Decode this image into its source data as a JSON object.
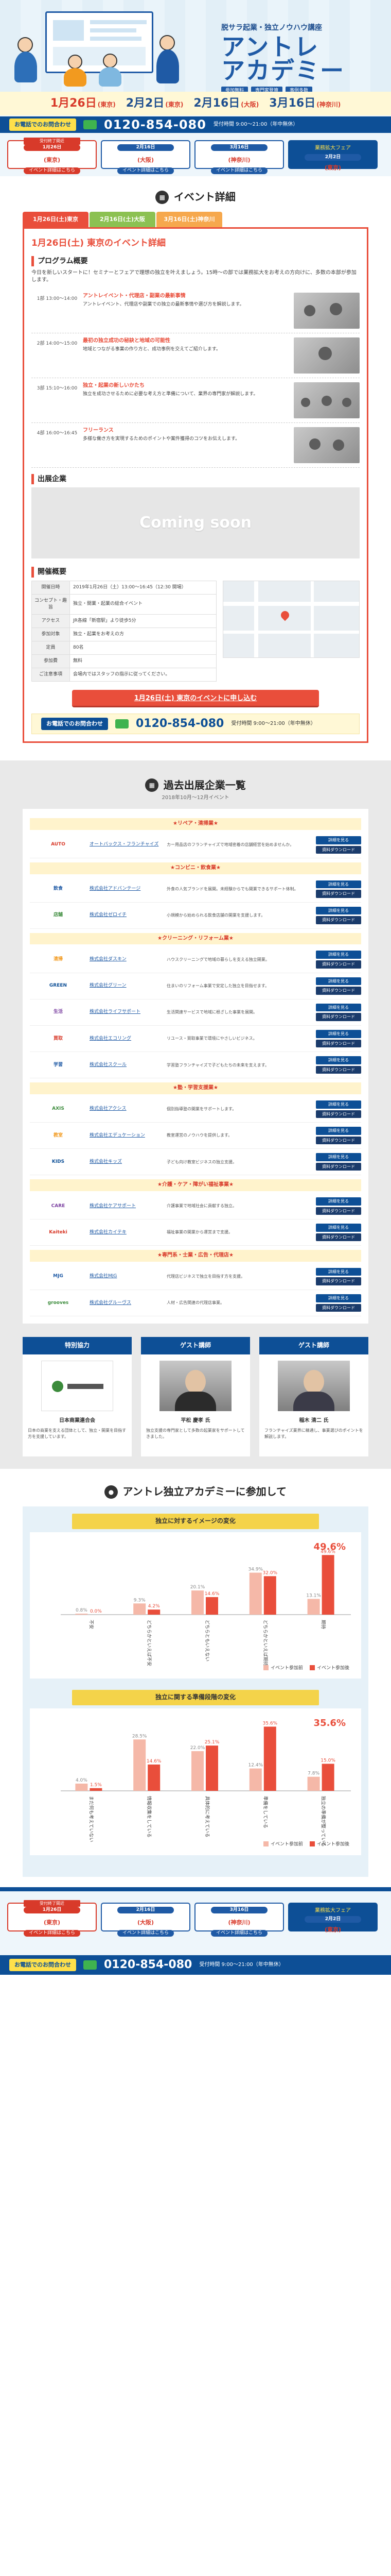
{
  "hero": {
    "subtitle": "脱サラ起業・独立ノウハウ講座",
    "title1": "アントレ",
    "title2": "アカデミー",
    "tags": [
      "参加無料",
      "専門家登壇",
      "事例多数"
    ]
  },
  "dates": [
    {
      "date": "1月26日",
      "day": "(東京)"
    },
    {
      "date": "2月2日",
      "day": "(東京)"
    },
    {
      "date": "2月16日",
      "day": "(大阪)"
    },
    {
      "date": "3月16日",
      "day": "(神奈川)"
    }
  ],
  "tel": {
    "label": "お電話でのお問合わせ",
    "number": "0120-854-080",
    "hours": "受付時間 9:00〜21:00（年中無休）"
  },
  "date_buttons": [
    {
      "date": "1月26日",
      "day": "(東京)",
      "sub": "イベント詳細はこちら",
      "ribbon": "受付終了間近"
    },
    {
      "date": "2月16日",
      "day": "(大阪)",
      "sub": "イベント詳細はこちら"
    },
    {
      "date": "3月16日",
      "day": "(神奈川)",
      "sub": "イベント詳細はこちら"
    },
    {
      "top": "業務拡大フェア",
      "date": "2月2日",
      "day": "(東京)",
      "sub": "イベント詳細はこちら"
    }
  ],
  "event_section": {
    "icon": "▦",
    "title": "イベント詳細"
  },
  "tabs": [
    "1月26日(土)東京",
    "2月16日(土)大阪",
    "3月16日(土)神奈川"
  ],
  "event": {
    "title": "1月26日(土) 東京のイベント詳細",
    "program_heading": "プログラム概要",
    "intro": "今日を新しいスタートに！セミナーとフェアで理想の独立を叶えましょう。15時〜の部では業務拡大をお考えの方向けに、多数の本部が参加します。",
    "program": [
      {
        "time": "1部\n13:00〜14:00",
        "head": "アントレイベント・代理店・副業の最新事情",
        "body": "アントレイベント、代理店や副業での独立の最新事情や選び方を解説します。"
      },
      {
        "time": "2部\n14:00〜15:00",
        "head": "最初の独立成功の秘訣と地域の可能性",
        "body": "地域とつながる事業の作り方と、成功事例を交えてご紹介します。"
      },
      {
        "time": "3部\n15:10〜16:00",
        "head": "独立・起業の新しいかたち",
        "body": "独立を成功させるために必要な考え方と準備について、業界の専門家が解説します。"
      },
      {
        "time": "4部\n16:00〜16:45",
        "head": "フリーランス",
        "body": "多様な働き方を実現するためのポイントや案件獲得のコツをお伝えします。"
      }
    ],
    "exhibitors_heading": "出展企業",
    "coming_soon": "Coming soon",
    "detail_heading": "開催概要",
    "detail_rows": [
      {
        "k": "開催日時",
        "v": "2019年1月26日（土）13:00〜16:45（12:30 開場）"
      },
      {
        "k": "コンセプト・趣旨",
        "v": "独立・開業・起業の総合イベント"
      },
      {
        "k": "アクセス",
        "v": "JR各線「新宿駅」より徒歩5分"
      },
      {
        "k": "参加対象",
        "v": "独立・起業をお考えの方"
      },
      {
        "k": "定員",
        "v": "80名"
      },
      {
        "k": "参加費",
        "v": "無料"
      },
      {
        "k": "ご注意事項",
        "v": "会場内ではスタッフの指示に従ってください。"
      }
    ],
    "cta": "1月26日(土) 東京のイベントに申し込む"
  },
  "past": {
    "icon": "▦",
    "title": "過去出展企業一覧",
    "sub": "2018年10月〜12月イベント",
    "buttons": [
      "詳細を見る",
      "資料ダウンロード"
    ],
    "categories": [
      {
        "name": "★リペア・清掃業★",
        "items": [
          {
            "logo": "AUTO",
            "name": "オートバックス・フランチャイズ",
            "desc": "カー用品店のフランチャイズで地域密着の店舗経営を始めませんか。"
          }
        ]
      },
      {
        "name": "★コンビニ・飲食業★",
        "items": [
          {
            "logo": "飲食",
            "name": "株式会社アドバンテージ",
            "desc": "外食の人気ブランドを展開。未経験からでも開業できるサポート体制。"
          },
          {
            "logo": "店舗",
            "name": "株式会社ゼロイチ",
            "desc": "小規模から始められる飲食店舗の開業を支援します。"
          }
        ]
      },
      {
        "name": "★クリーニング・リフォーム業★",
        "items": [
          {
            "logo": "清掃",
            "name": "株式会社ダスキン",
            "desc": "ハウスクリーニングで地域の暮らしを支える独立開業。"
          },
          {
            "logo": "GREEN",
            "name": "株式会社グリーン",
            "desc": "住まいのリフォーム事業で安定した独立を目指せます。"
          },
          {
            "logo": "生活",
            "name": "株式会社ライフサポート",
            "desc": "生活関連サービスで地域に根ざした事業を展開。"
          },
          {
            "logo": "買取",
            "name": "株式会社エコリング",
            "desc": "リユース・買取事業で環境にやさしいビジネス。"
          },
          {
            "logo": "学習",
            "name": "株式会社スクール",
            "desc": "学習塾フランチャイズで子どもたちの未来を支えます。"
          }
        ]
      },
      {
        "name": "★塾・学習支援業★",
        "items": [
          {
            "logo": "AXIS",
            "name": "株式会社アクシス",
            "desc": "個別指導塾の開業をサポートします。"
          },
          {
            "logo": "教室",
            "name": "株式会社エデュケーション",
            "desc": "教室運営のノウハウを提供します。"
          },
          {
            "logo": "KIDS",
            "name": "株式会社キッズ",
            "desc": "子ども向け教室ビジネスの独立支援。"
          }
        ]
      },
      {
        "name": "★介護・ケア・障がい福祉事業★",
        "items": [
          {
            "logo": "CARE",
            "name": "株式会社ケアサポート",
            "desc": "介護事業で地域社会に貢献する独立。"
          },
          {
            "logo": "Kaiteki",
            "name": "株式会社カイテキ",
            "desc": "福祉事業の開業から運営まで支援。"
          }
        ]
      },
      {
        "name": "★専門系・士業・広告・代理店★",
        "items": [
          {
            "logo": "MJG",
            "name": "株式会社MJG",
            "desc": "代理店ビジネスで独立を目指す方を支援。"
          },
          {
            "logo": "grooves",
            "name": "株式会社グルーヴス",
            "desc": "人材・広告関連の代理店事業。"
          }
        ]
      }
    ]
  },
  "speakers": [
    {
      "title": "特別協力",
      "name": "日本商業連合会",
      "text": "日本の商業を支える団体として、独立・開業を目指す方を支援しています。"
    },
    {
      "title": "ゲスト講師",
      "name": "平松 慶孝 氏",
      "text": "独立支援の専門家として多数の起業家をサポートしてきました。"
    },
    {
      "title": "ゲスト講師",
      "name": "稲木 清二 氏",
      "text": "フランチャイズ業界に精通し、事業選びのポイントを解説します。"
    }
  ],
  "join": {
    "icon": "●",
    "title": "アントレ独立アカデミーに参加して",
    "chart1_title": "独立に対するイメージの変化",
    "chart2_title": "独立に関する準備段階の変化"
  },
  "chart_data": [
    {
      "type": "bar",
      "title": "独立に対するイメージの変化",
      "categories": [
        "不安",
        "どちらかといえば不安",
        "どちらともいえない",
        "どちらかといえば期待",
        "期待"
      ],
      "series": [
        {
          "name": "イベント参加前",
          "values": [
            0.8,
            9.3,
            20.1,
            34.9,
            13.1
          ]
        },
        {
          "name": "イベント参加後",
          "values": [
            0.0,
            4.2,
            14.6,
            32.0,
            49.6
          ]
        }
      ],
      "labels": [
        "49.6%"
      ],
      "ylim": [
        0,
        60
      ]
    },
    {
      "type": "bar",
      "title": "独立に関する準備段階の変化",
      "categories": [
        "まだ何も考えていない",
        "情報収集をしている",
        "具体的に考えている",
        "準備をしている",
        "独立の準備が整っている"
      ],
      "series": [
        {
          "name": "イベント参加前",
          "values": [
            4.0,
            28.5,
            22.0,
            12.4,
            7.8
          ]
        },
        {
          "name": "イベント参加後",
          "values": [
            1.5,
            14.6,
            25.1,
            35.6,
            15.0
          ]
        }
      ],
      "labels": [
        "35.6%"
      ],
      "ylim": [
        0,
        40
      ]
    }
  ],
  "colors": {
    "primary": "#1f5aa5",
    "accent": "#e94e3b",
    "dark": "#0d4f96",
    "yellow": "#f4d34a"
  }
}
